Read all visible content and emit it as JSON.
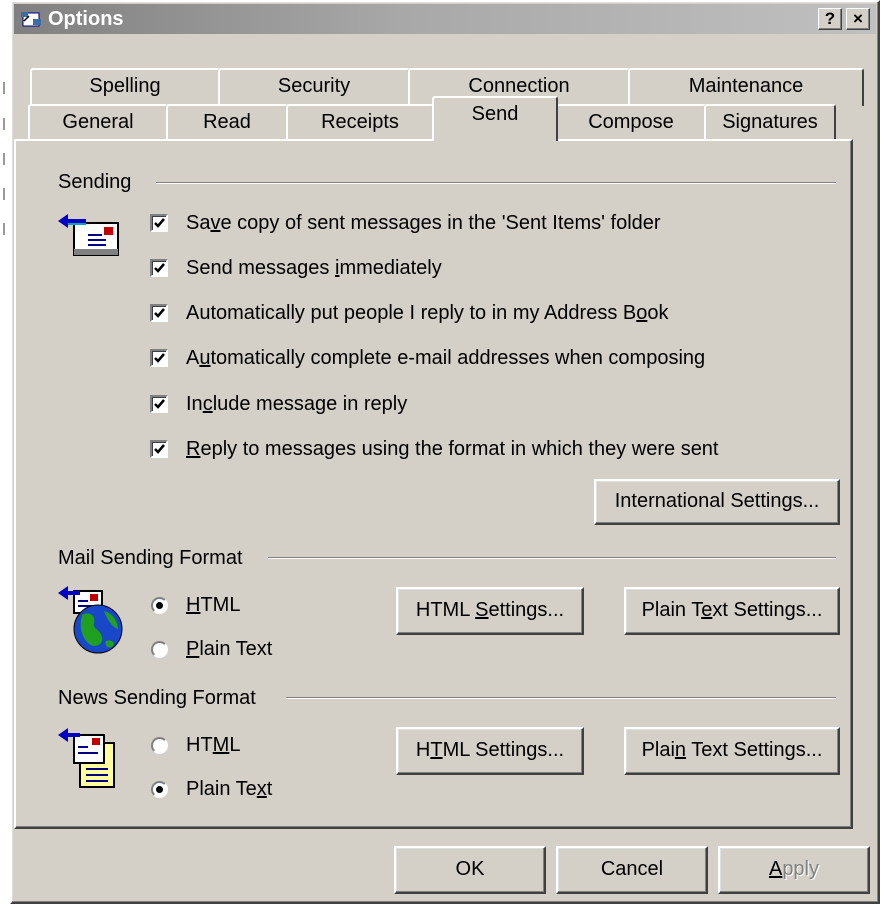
{
  "window": {
    "title": "Options",
    "help_glyph": "?",
    "close_glyph": "×"
  },
  "tabs_row1": [
    {
      "label": "Spelling"
    },
    {
      "label": "Security"
    },
    {
      "label": "Connection"
    },
    {
      "label": "Maintenance"
    }
  ],
  "tabs_row2": [
    {
      "label": "General"
    },
    {
      "label": "Read"
    },
    {
      "label": "Receipts"
    },
    {
      "label": "Send",
      "active": true
    },
    {
      "label": "Compose"
    },
    {
      "label": "Signatures"
    }
  ],
  "sending": {
    "heading": "Sending",
    "icon": "send-mail-icon",
    "options": [
      {
        "pre": "Sa",
        "u": "v",
        "post": "e copy of sent messages in the 'Sent Items' folder",
        "checked": true
      },
      {
        "pre": "Send messages ",
        "u": "i",
        "post": "mmediately",
        "checked": true
      },
      {
        "pre": "Automatically put people I reply to in my Address B",
        "u": "o",
        "post": "ok",
        "checked": true
      },
      {
        "pre": "A",
        "u": "u",
        "post": "tomatically complete e-mail addresses when composing",
        "checked": true
      },
      {
        "pre": "In",
        "u": "c",
        "post": "lude message in reply",
        "checked": true
      },
      {
        "pre": "",
        "u": "R",
        "post": "eply to messages using the format in which they were sent",
        "checked": true
      }
    ],
    "international_button": "International Settings..."
  },
  "mail_format": {
    "heading": "Mail Sending Format",
    "icon": "globe-mail-icon",
    "html": {
      "pre": "",
      "u": "H",
      "post": "TML",
      "selected": true
    },
    "plain": {
      "pre": "",
      "u": "P",
      "post": "lain Text",
      "selected": false
    },
    "html_settings": {
      "pre": "HTML ",
      "u": "S",
      "post": "ettings..."
    },
    "plain_settings": {
      "pre": "Plain T",
      "u": "e",
      "post": "xt Settings..."
    }
  },
  "news_format": {
    "heading": "News Sending Format",
    "icon": "news-document-icon",
    "html": {
      "pre": "HT",
      "u": "M",
      "post": "L",
      "selected": false
    },
    "plain": {
      "pre": "Plain Te",
      "u": "x",
      "post": "t",
      "selected": true
    },
    "html_settings": {
      "pre": "H",
      "u": "T",
      "post": "ML Settings..."
    },
    "plain_settings": {
      "pre": "Plai",
      "u": "n",
      "post": " Text Settings..."
    }
  },
  "footer": {
    "ok": "OK",
    "cancel": "Cancel",
    "apply": {
      "pre": "",
      "u": "A",
      "post": "pply",
      "disabled": true
    }
  }
}
